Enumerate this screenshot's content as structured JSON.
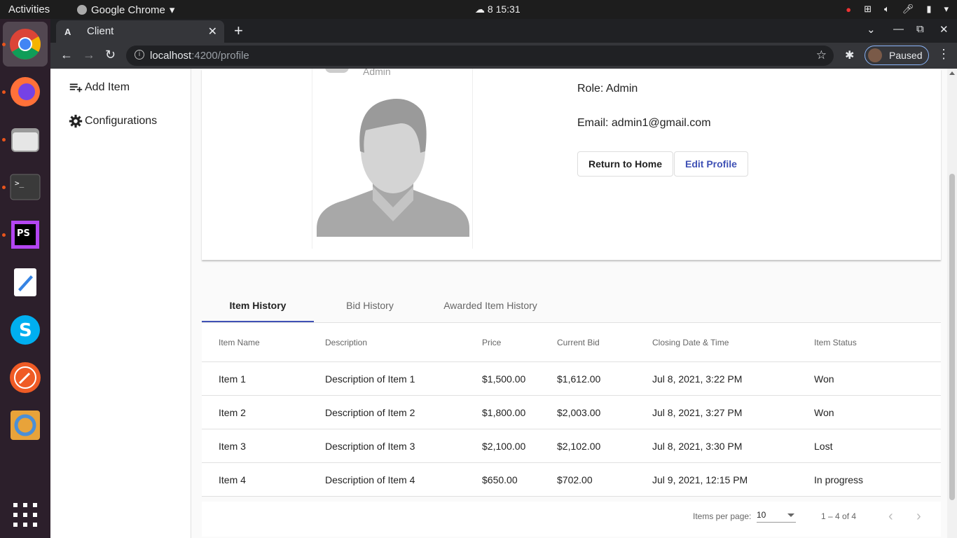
{
  "topbar": {
    "activities": "Activities",
    "app_name": "Google Chrome",
    "clock_day": "8",
    "clock_time": "15:31"
  },
  "dock": {
    "items": [
      "chrome-icon",
      "firefox-icon",
      "files-icon",
      "terminal-icon",
      "phpstorm-icon",
      "text-editor-icon",
      "skype-icon",
      "postman-icon",
      "blender-like-icon",
      "app-grid-icon"
    ]
  },
  "browser": {
    "tab_title": "Client",
    "tab_favicon": "A",
    "url_host": "localhost",
    "url_path": ":4200/profile",
    "profile_label": "Paused"
  },
  "sidenav": {
    "items": [
      {
        "label": "Add Item",
        "icon": "playlist-add-icon"
      },
      {
        "label": "Configurations",
        "icon": "gear-icon"
      }
    ]
  },
  "profile": {
    "role_subtitle": "Admin",
    "role_line": "Role: Admin",
    "email_line": "Email: admin1@gmail.com",
    "return_button": "Return to Home",
    "edit_button": "Edit Profile"
  },
  "tabs": [
    "Item History",
    "Bid History",
    "Awarded Item History"
  ],
  "table": {
    "headers": [
      "Item Name",
      "Description",
      "Price",
      "Current Bid",
      "Closing Date & Time",
      "Item Status"
    ],
    "rows": [
      [
        "Item 1",
        "Description of Item 1",
        "$1,500.00",
        "$1,612.00",
        "Jul 8, 2021, 3:22 PM",
        "Won"
      ],
      [
        "Item 2",
        "Description of Item 2",
        "$1,800.00",
        "$2,003.00",
        "Jul 8, 2021, 3:27 PM",
        "Won"
      ],
      [
        "Item 3",
        "Description of Item 3",
        "$2,100.00",
        "$2,102.00",
        "Jul 8, 2021, 3:30 PM",
        "Lost"
      ],
      [
        "Item 4",
        "Description of Item 4",
        "$650.00",
        "$702.00",
        "Jul 9, 2021, 12:15 PM",
        "In progress"
      ]
    ]
  },
  "paginator": {
    "label": "Items per page:",
    "page_size": "10",
    "range": "1 – 4 of 4"
  },
  "colors": {
    "accent": "#3f51b5",
    "chrome_dark": "#202124",
    "dock_bg": "#2c1f2b"
  }
}
